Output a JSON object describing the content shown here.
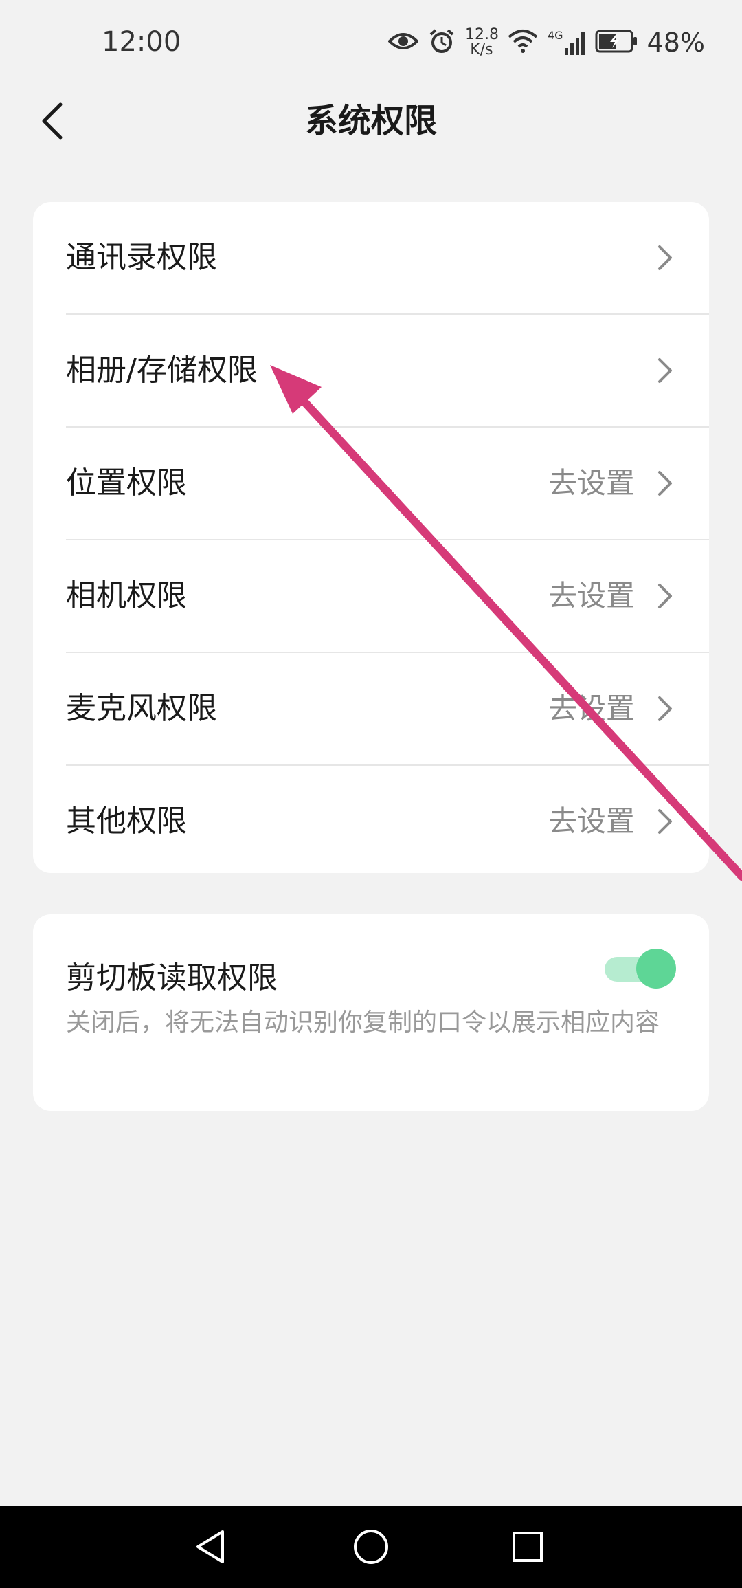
{
  "status_bar": {
    "time": "12:00",
    "net_speed_value": "12.8",
    "net_speed_unit": "K/s",
    "network_type": "4G",
    "battery": "48%",
    "icons": [
      "eye-icon",
      "alarm-icon",
      "wifi-icon",
      "signal-icon",
      "battery-icon"
    ]
  },
  "header": {
    "title": "系统权限",
    "back_icon": "chevron-left-icon"
  },
  "permissions": [
    {
      "label": "通讯录权限",
      "status": ""
    },
    {
      "label": "相册/存储权限",
      "status": ""
    },
    {
      "label": "位置权限",
      "status": "去设置"
    },
    {
      "label": "相机权限",
      "status": "去设置"
    },
    {
      "label": "麦克风权限",
      "status": "去设置"
    },
    {
      "label": "其他权限",
      "status": "去设置"
    }
  ],
  "clipboard": {
    "title": "剪切板读取权限",
    "description": "关闭后，将无法自动识别你复制的口令以展示相应内容",
    "enabled": true
  },
  "colors": {
    "background": "#f2f2f2",
    "card": "#ffffff",
    "toggle_on": "#5ed696",
    "annotation": "#d63a78"
  },
  "system_nav": {
    "icons": [
      "back-triangle-icon",
      "home-circle-icon",
      "recents-square-icon"
    ]
  }
}
